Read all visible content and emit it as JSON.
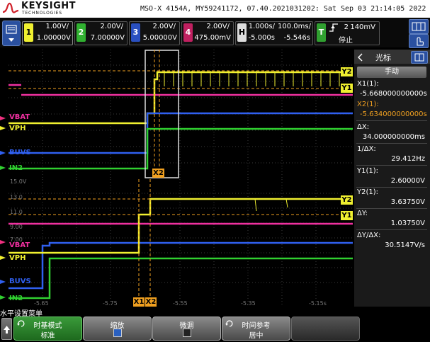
{
  "header": {
    "brand": "KEYSIGHT",
    "brand_sub": "TECHNOLOGIES",
    "title": "MSO-X 4154A, MY59241172, 07.40.2021031202: Sat Sep 03 21:14:05 2022"
  },
  "channels": [
    {
      "num": "1",
      "scale": "1.00V/",
      "offset": "1.00000V",
      "color": "#f0f030"
    },
    {
      "num": "2",
      "scale": "2.00V/",
      "offset": "7.00000V",
      "color": "#30d030"
    },
    {
      "num": "3",
      "scale": "2.00V/",
      "offset": "5.00000V",
      "color": "#3060f0"
    },
    {
      "num": "4",
      "scale": "2.00V/",
      "offset": "475.00mV",
      "color": "#f03080"
    }
  ],
  "horizontal": {
    "label": "H",
    "scale": "1.000s/",
    "delay": "-5.000s"
  },
  "zoom": {
    "scale": "100.0ms/",
    "delay": "-5.546s"
  },
  "trigger": {
    "label": "T",
    "state": "停止",
    "level": "140mV",
    "channel": "2"
  },
  "cursor_panel": {
    "header": "光标",
    "mode": "手动",
    "x1_label": "X1(1):",
    "x1_value": "-5.668000000000s",
    "x2_label": "X2(1):",
    "x2_value": "-5.634000000000s",
    "dx_label": "ΔX:",
    "dx_value": "34.000000000ms",
    "inv_dx_label": "1/ΔX:",
    "inv_dx_value": "29.412Hz",
    "y1_label": "Y1(1):",
    "y1_value": "2.60000V",
    "y2_label": "Y2(1):",
    "y2_value": "3.63750V",
    "dy_label": "ΔY:",
    "dy_value": "1.03750V",
    "dydx_label": "ΔY/ΔX:",
    "dydx_value": "30.5147V/s"
  },
  "traces": {
    "vbat": "VBAT",
    "vph": "VPH",
    "buvs": "BUVS",
    "in2": "IN2"
  },
  "markers": {
    "x1": "X1",
    "x2": "X2",
    "y1": "Y1",
    "y2": "Y2"
  },
  "zoom_scale_labels": [
    "15.0V",
    "13.0",
    "11.0",
    "9.00",
    "7.00"
  ],
  "zoom_time_labels": [
    "-5.65",
    "-5.75",
    "-5.55",
    "-5.35",
    "-5.15s"
  ],
  "menu": {
    "title": "水平设置菜单",
    "softkeys": [
      {
        "line1": "时基模式",
        "line2": "标准"
      },
      {
        "line1": "缩放",
        "line2": ""
      },
      {
        "line1": "微调",
        "line2": ""
      },
      {
        "line1": "时间参考",
        "line2": "居中"
      }
    ]
  },
  "colors": {
    "ch1": "#f0f030",
    "ch2": "#30d030",
    "ch3": "#3060f0",
    "ch4": "#f03080",
    "cursor": "#f0a020"
  }
}
